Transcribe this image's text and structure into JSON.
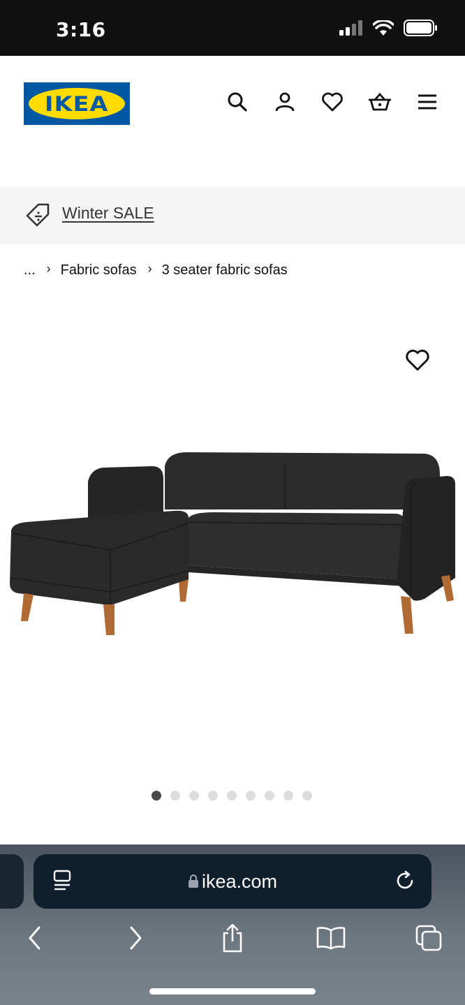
{
  "status_bar": {
    "time": "3:16"
  },
  "header": {
    "logo_text": "IKEA",
    "nav_icons": [
      "search-icon",
      "account-icon",
      "favorites-icon",
      "basket-icon",
      "menu-icon"
    ]
  },
  "promo": {
    "icon": "price-tag-icon",
    "label": "Winter SALE"
  },
  "breadcrumb": {
    "ellipsis": "...",
    "items": [
      "Fabric sofas",
      "3 seater fabric sofas"
    ]
  },
  "product": {
    "image": "dark grey chaise sofa with wooden legs",
    "image_count": 9,
    "active_image_index": 0
  },
  "browser": {
    "url": "ikea.com",
    "toolbar": [
      "back-icon",
      "forward-icon",
      "share-icon",
      "bookmarks-icon",
      "tabs-icon"
    ]
  },
  "colors": {
    "ikea_blue": "#0058a3",
    "ikea_yellow": "#ffdb00",
    "status_bar": "#111111",
    "promo_bg": "#f5f5f5"
  }
}
